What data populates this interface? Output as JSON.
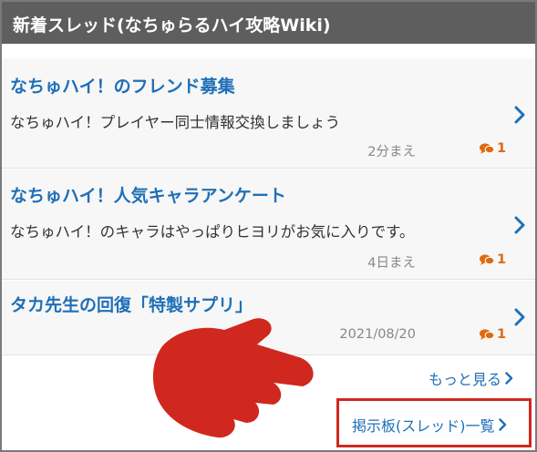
{
  "header": {
    "title": "新着スレッド(なちゅらるハイ攻略Wiki)"
  },
  "threads": [
    {
      "title": "なちゅハイ！のフレンド募集",
      "description": "なちゅハイ！プレイヤー同士情報交換しましょう",
      "time": "2分まえ",
      "comments": "1"
    },
    {
      "title": "なちゅハイ！人気キャラアンケート",
      "description": "なちゅハイ！のキャラはやっぱりヒヨリがお気に入りです。",
      "time": "4日まえ",
      "comments": "1"
    },
    {
      "title": "タカ先生の回復「特製サプリ」",
      "description": "",
      "time": "2021/08/20",
      "comments": "1"
    }
  ],
  "footer": {
    "more_label": "もっと見る",
    "board_label": "掲示板(スレッド)一覧"
  },
  "colors": {
    "header_bg": "#5e5e5e",
    "link": "#1f6fb7",
    "comment": "#e06a10",
    "highlight_box": "#d0281e",
    "pointer_hand": "#d0281e"
  },
  "icons": {
    "thread_arrow": "chevron-right-icon",
    "comment": "comment-bubbles-icon",
    "annotation": "pointing-hand-icon"
  }
}
